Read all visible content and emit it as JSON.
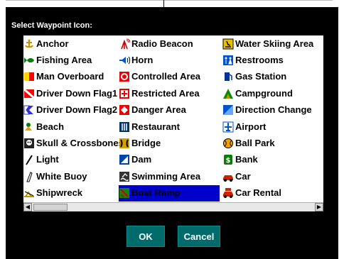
{
  "dialog": {
    "title": "Select Waypoint Icon:",
    "ok_label": "OK",
    "cancel_label": "Cancel"
  },
  "columns": [
    [
      {
        "label": "Anchor",
        "icon": "anchor-icon"
      },
      {
        "label": "Fishing Area",
        "icon": "fish-icon"
      },
      {
        "label": "Man Overboard",
        "icon": "man-overboard-flag-icon"
      },
      {
        "label": "Driver Down Flag1",
        "icon": "diver-down-flag1-icon"
      },
      {
        "label": "Driver Down Flag2",
        "icon": "diver-down-flag2-icon"
      },
      {
        "label": "Beach",
        "icon": "beach-icon"
      },
      {
        "label": "Skull & Crossbones",
        "icon": "skull-crossbones-icon"
      },
      {
        "label": "Light",
        "icon": "light-icon"
      },
      {
        "label": "White Buoy",
        "icon": "white-buoy-icon"
      },
      {
        "label": "Shipwreck",
        "icon": "shipwreck-icon"
      }
    ],
    [
      {
        "label": "Radio Beacon",
        "icon": "radio-beacon-icon"
      },
      {
        "label": "Horn",
        "icon": "horn-icon"
      },
      {
        "label": "Controlled Area",
        "icon": "controlled-area-icon"
      },
      {
        "label": "Restricted Area",
        "icon": "restricted-area-icon"
      },
      {
        "label": "Danger Area",
        "icon": "danger-area-icon"
      },
      {
        "label": "Restaurant",
        "icon": "restaurant-icon"
      },
      {
        "label": "Bridge",
        "icon": "bridge-icon"
      },
      {
        "label": "Dam",
        "icon": "dam-icon"
      },
      {
        "label": "Swimming Area",
        "icon": "swimming-area-icon"
      },
      {
        "label": "Boat Ramp",
        "icon": "boat-ramp-icon",
        "selected": true
      }
    ],
    [
      {
        "label": "Water Skiing Area",
        "icon": "water-skiing-icon"
      },
      {
        "label": "Restrooms",
        "icon": "restrooms-icon"
      },
      {
        "label": "Gas Station",
        "icon": "gas-station-icon"
      },
      {
        "label": "Campground",
        "icon": "campground-icon"
      },
      {
        "label": "Direction Change",
        "icon": "direction-change-icon"
      },
      {
        "label": "Airport",
        "icon": "airport-icon"
      },
      {
        "label": "Ball Park",
        "icon": "ball-park-icon"
      },
      {
        "label": "Bank",
        "icon": "bank-icon"
      },
      {
        "label": "Car",
        "icon": "car-icon"
      },
      {
        "label": "Car Rental",
        "icon": "car-rental-icon"
      }
    ]
  ],
  "colors": {
    "selection": "#0000cc",
    "button": "#006b6b"
  }
}
